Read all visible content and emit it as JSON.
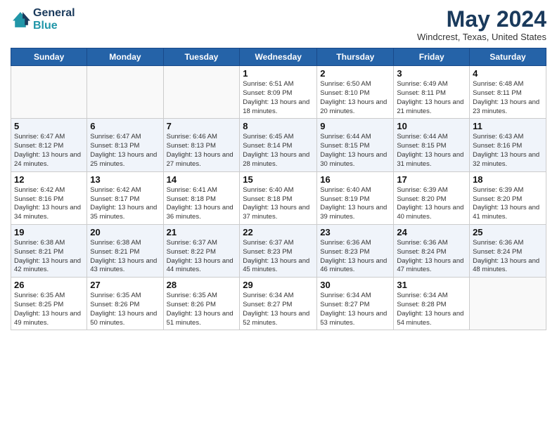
{
  "header": {
    "logo_line1": "General",
    "logo_line2": "Blue",
    "month_year": "May 2024",
    "location": "Windcrest, Texas, United States"
  },
  "days_of_week": [
    "Sunday",
    "Monday",
    "Tuesday",
    "Wednesday",
    "Thursday",
    "Friday",
    "Saturday"
  ],
  "weeks": [
    [
      {
        "day": "",
        "info": ""
      },
      {
        "day": "",
        "info": ""
      },
      {
        "day": "",
        "info": ""
      },
      {
        "day": "1",
        "info": "Sunrise: 6:51 AM\nSunset: 8:09 PM\nDaylight: 13 hours and 18 minutes."
      },
      {
        "day": "2",
        "info": "Sunrise: 6:50 AM\nSunset: 8:10 PM\nDaylight: 13 hours and 20 minutes."
      },
      {
        "day": "3",
        "info": "Sunrise: 6:49 AM\nSunset: 8:11 PM\nDaylight: 13 hours and 21 minutes."
      },
      {
        "day": "4",
        "info": "Sunrise: 6:48 AM\nSunset: 8:11 PM\nDaylight: 13 hours and 23 minutes."
      }
    ],
    [
      {
        "day": "5",
        "info": "Sunrise: 6:47 AM\nSunset: 8:12 PM\nDaylight: 13 hours and 24 minutes."
      },
      {
        "day": "6",
        "info": "Sunrise: 6:47 AM\nSunset: 8:13 PM\nDaylight: 13 hours and 25 minutes."
      },
      {
        "day": "7",
        "info": "Sunrise: 6:46 AM\nSunset: 8:13 PM\nDaylight: 13 hours and 27 minutes."
      },
      {
        "day": "8",
        "info": "Sunrise: 6:45 AM\nSunset: 8:14 PM\nDaylight: 13 hours and 28 minutes."
      },
      {
        "day": "9",
        "info": "Sunrise: 6:44 AM\nSunset: 8:15 PM\nDaylight: 13 hours and 30 minutes."
      },
      {
        "day": "10",
        "info": "Sunrise: 6:44 AM\nSunset: 8:15 PM\nDaylight: 13 hours and 31 minutes."
      },
      {
        "day": "11",
        "info": "Sunrise: 6:43 AM\nSunset: 8:16 PM\nDaylight: 13 hours and 32 minutes."
      }
    ],
    [
      {
        "day": "12",
        "info": "Sunrise: 6:42 AM\nSunset: 8:16 PM\nDaylight: 13 hours and 34 minutes."
      },
      {
        "day": "13",
        "info": "Sunrise: 6:42 AM\nSunset: 8:17 PM\nDaylight: 13 hours and 35 minutes."
      },
      {
        "day": "14",
        "info": "Sunrise: 6:41 AM\nSunset: 8:18 PM\nDaylight: 13 hours and 36 minutes."
      },
      {
        "day": "15",
        "info": "Sunrise: 6:40 AM\nSunset: 8:18 PM\nDaylight: 13 hours and 37 minutes."
      },
      {
        "day": "16",
        "info": "Sunrise: 6:40 AM\nSunset: 8:19 PM\nDaylight: 13 hours and 39 minutes."
      },
      {
        "day": "17",
        "info": "Sunrise: 6:39 AM\nSunset: 8:20 PM\nDaylight: 13 hours and 40 minutes."
      },
      {
        "day": "18",
        "info": "Sunrise: 6:39 AM\nSunset: 8:20 PM\nDaylight: 13 hours and 41 minutes."
      }
    ],
    [
      {
        "day": "19",
        "info": "Sunrise: 6:38 AM\nSunset: 8:21 PM\nDaylight: 13 hours and 42 minutes."
      },
      {
        "day": "20",
        "info": "Sunrise: 6:38 AM\nSunset: 8:21 PM\nDaylight: 13 hours and 43 minutes."
      },
      {
        "day": "21",
        "info": "Sunrise: 6:37 AM\nSunset: 8:22 PM\nDaylight: 13 hours and 44 minutes."
      },
      {
        "day": "22",
        "info": "Sunrise: 6:37 AM\nSunset: 8:23 PM\nDaylight: 13 hours and 45 minutes."
      },
      {
        "day": "23",
        "info": "Sunrise: 6:36 AM\nSunset: 8:23 PM\nDaylight: 13 hours and 46 minutes."
      },
      {
        "day": "24",
        "info": "Sunrise: 6:36 AM\nSunset: 8:24 PM\nDaylight: 13 hours and 47 minutes."
      },
      {
        "day": "25",
        "info": "Sunrise: 6:36 AM\nSunset: 8:24 PM\nDaylight: 13 hours and 48 minutes."
      }
    ],
    [
      {
        "day": "26",
        "info": "Sunrise: 6:35 AM\nSunset: 8:25 PM\nDaylight: 13 hours and 49 minutes."
      },
      {
        "day": "27",
        "info": "Sunrise: 6:35 AM\nSunset: 8:26 PM\nDaylight: 13 hours and 50 minutes."
      },
      {
        "day": "28",
        "info": "Sunrise: 6:35 AM\nSunset: 8:26 PM\nDaylight: 13 hours and 51 minutes."
      },
      {
        "day": "29",
        "info": "Sunrise: 6:34 AM\nSunset: 8:27 PM\nDaylight: 13 hours and 52 minutes."
      },
      {
        "day": "30",
        "info": "Sunrise: 6:34 AM\nSunset: 8:27 PM\nDaylight: 13 hours and 53 minutes."
      },
      {
        "day": "31",
        "info": "Sunrise: 6:34 AM\nSunset: 8:28 PM\nDaylight: 13 hours and 54 minutes."
      },
      {
        "day": "",
        "info": ""
      }
    ]
  ]
}
